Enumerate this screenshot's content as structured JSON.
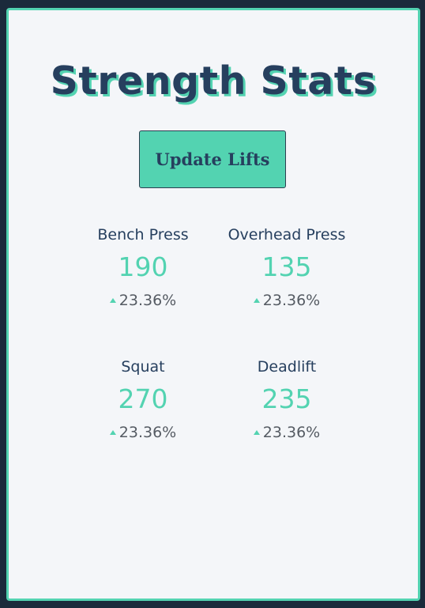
{
  "page": {
    "title": "Strength Stats",
    "update_button_label": "Update Lifts"
  },
  "stats": [
    {
      "label": "Bench Press",
      "value": "190",
      "change": "23.36%"
    },
    {
      "label": "Overhead Press",
      "value": "135",
      "change": "23.36%"
    },
    {
      "label": "Squat",
      "value": "270",
      "change": "23.36%"
    },
    {
      "label": "Deadlift",
      "value": "235",
      "change": "23.36%"
    }
  ],
  "colors": {
    "background": "#1b2a3b",
    "card": "#f4f6f9",
    "accent": "#53d3b1",
    "heading": "#263f5e",
    "muted": "#555b63"
  },
  "icons": {
    "change_indicator": "arrow-up-icon"
  }
}
